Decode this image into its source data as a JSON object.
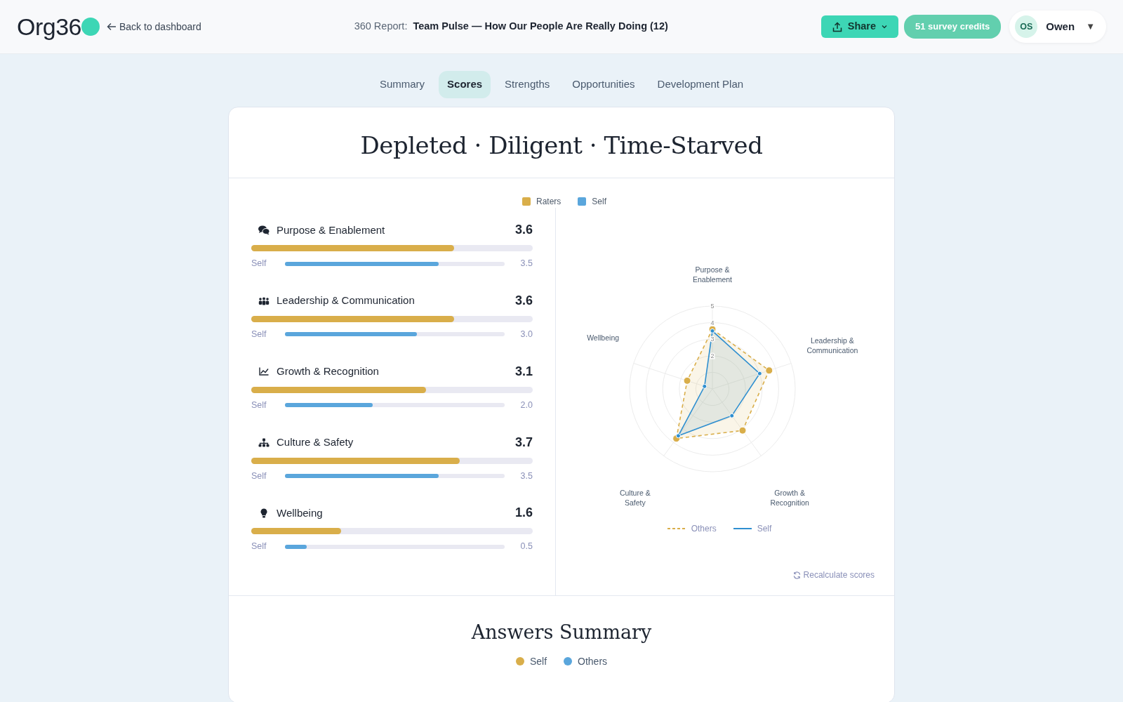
{
  "header": {
    "logo": "Org36",
    "back_link": "Back to dashboard",
    "report_label": "360 Report:",
    "report_title": "Team Pulse — How Our People Are Really Doing (12)",
    "share_button": "Share",
    "credits": "51 survey credits",
    "user": {
      "initials": "OS",
      "name": "Owen",
      "caret": "▼"
    }
  },
  "tabs": [
    {
      "label": "Summary",
      "selected": false
    },
    {
      "label": "Scores",
      "selected": true
    },
    {
      "label": "Strengths",
      "selected": false
    },
    {
      "label": "Opportunities",
      "selected": false
    },
    {
      "label": "Development Plan",
      "selected": false
    }
  ],
  "headline": "Depleted · Diligent · Time-Starved",
  "legend": [
    {
      "label": "Raters",
      "color": "#d9ae4a"
    },
    {
      "label": "Self",
      "color": "#5aa6dc"
    }
  ],
  "scores": [
    {
      "name": "Purpose & Enablement",
      "score": "3.6",
      "raters": {
        "level": 0.72
      },
      "self": {
        "label": "Self",
        "level": 0.7,
        "score": "3.5"
      }
    },
    {
      "name": "Leadership & Communication",
      "score": "3.6",
      "raters": {
        "level": 0.72
      },
      "self": {
        "label": "Self",
        "level": 0.6,
        "score": "3.0"
      }
    },
    {
      "name": "Growth & Recognition",
      "score": "3.1",
      "raters": {
        "level": 0.62
      },
      "self": {
        "label": "Self",
        "level": 0.4,
        "score": "2.0"
      }
    },
    {
      "name": "Culture & Safety",
      "score": "3.7",
      "raters": {
        "level": 0.74
      },
      "self": {
        "label": "Self",
        "level": 0.7,
        "score": "3.5"
      }
    },
    {
      "name": "Wellbeing",
      "score": "1.6",
      "raters": {
        "level": 0.32
      },
      "self": {
        "label": "Self",
        "level": 0.1,
        "score": "0.5"
      }
    }
  ],
  "radar": {
    "chart_data": {
      "type": "radar",
      "categories": [
        "Purpose & Enablement",
        "Leadership & Communication",
        "Growth & Recognition",
        "Culture & Safety",
        "Wellbeing"
      ],
      "ylim": [
        0,
        5
      ],
      "yticks": [
        2,
        3,
        4,
        5
      ],
      "series": [
        {
          "name": "Others",
          "color": "#d9ae4a",
          "values": [
            3.6,
            3.6,
            3.1,
            3.7,
            1.6
          ]
        },
        {
          "name": "Self",
          "color": "#2f8fd0",
          "values": [
            3.5,
            3.0,
            2.0,
            3.5,
            0.5
          ]
        }
      ]
    },
    "recalculate": "Recalculate scores"
  },
  "answers_summary": {
    "title": "Answers Summary",
    "legend": [
      {
        "label": "Self",
        "color": "#d9ae4a"
      },
      {
        "label": "Others",
        "color": "#5aa6dc"
      }
    ]
  }
}
